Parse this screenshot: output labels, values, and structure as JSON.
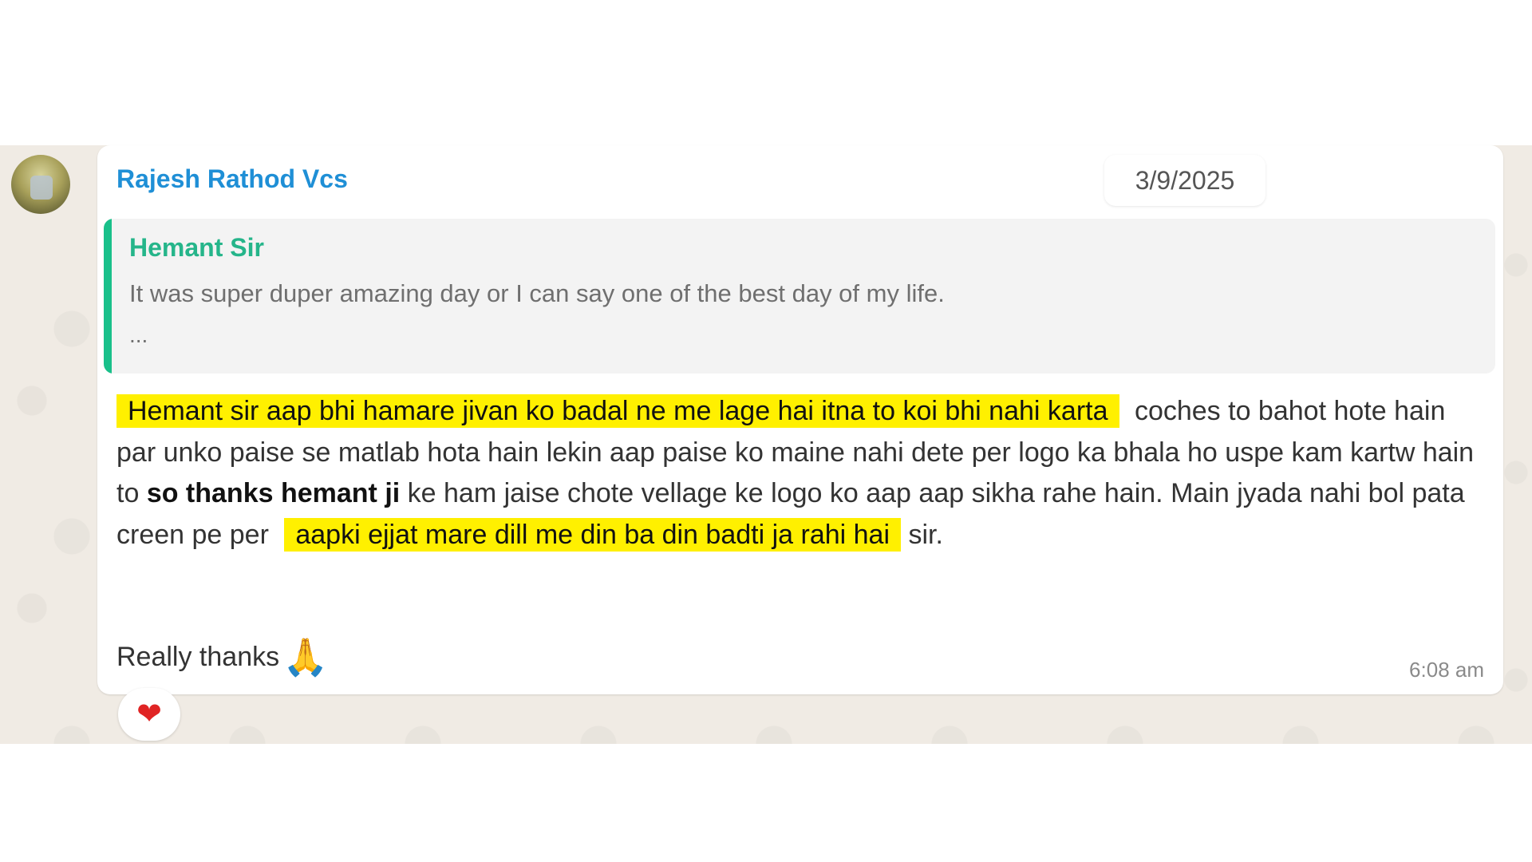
{
  "chat": {
    "sender_name": "Rajesh Rathod Vcs",
    "date": "3/9/2025",
    "quote": {
      "author": "Hemant Sir",
      "text": "It was super duper amazing day or I can say one of the best day of my life.",
      "ellipsis": "..."
    },
    "message": {
      "highlight_1": "Hemant sir aap bhi hamare jivan ko badal ne me lage hai itna to koi bhi nahi karta",
      "part_1": "coches to bahot hote hain par unko paise se matlab hota hain lekin aap paise ko maine nahi dete per logo ka bhala ho uspe kam kartw hain to",
      "bold": "so thanks hemant ji",
      "part_2": "ke ham jaise chote vellage ke logo ko aap aap sikha rahe hain. Main jyada nahi bol pata creen pe per",
      "highlight_2": "aapki ejjat mare dill me din ba din badti ja rahi hai",
      "part_3": "sir."
    },
    "closing": "Really thanks",
    "closing_emoji": "🙏",
    "time": "6:08 am",
    "reaction_emoji": "❤",
    "highlight_color": "#fff000",
    "sender_color": "#1f8fd6",
    "quote_accent_color": "#19c08a",
    "icons": {
      "avatar": "avatar-photo",
      "pray": "folded-hands-icon",
      "reaction": "heart-icon"
    }
  }
}
